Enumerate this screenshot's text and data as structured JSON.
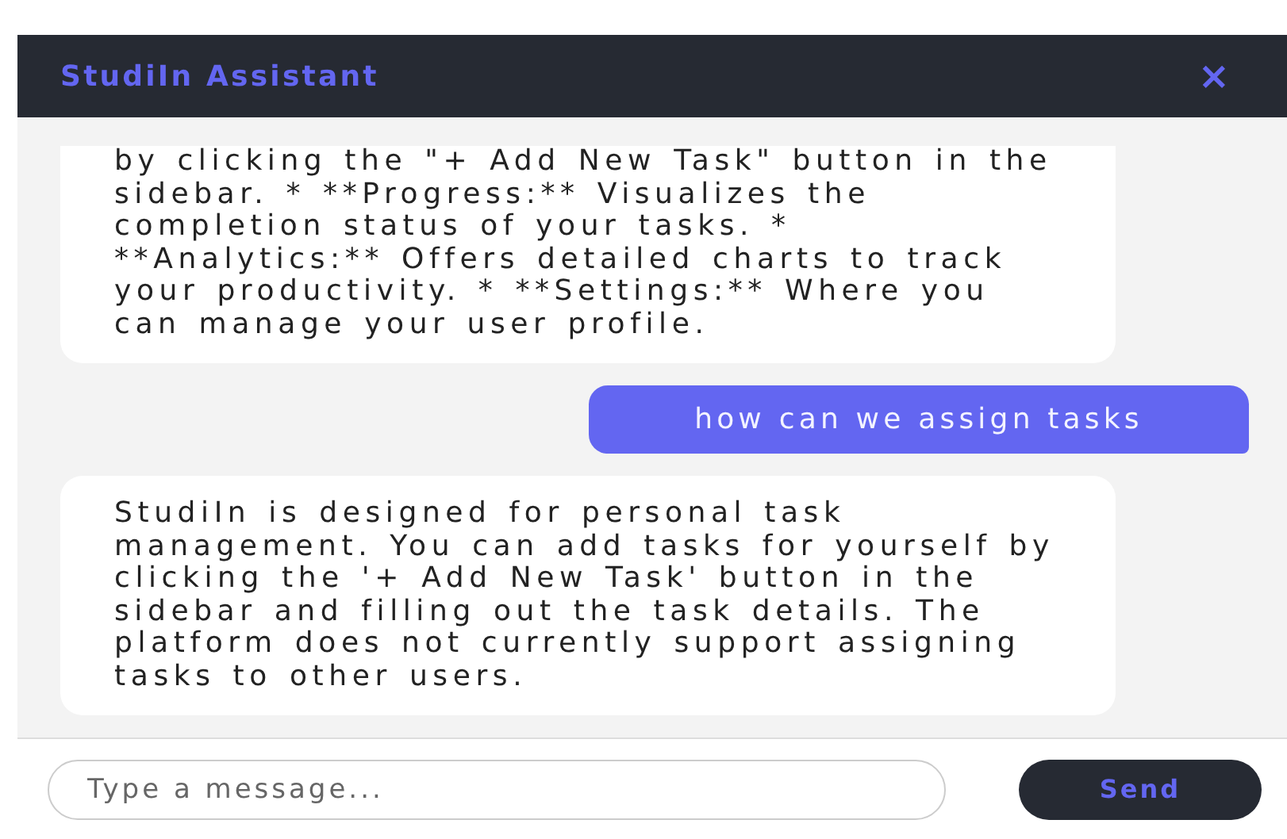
{
  "header": {
    "title": "StudiIn Assistant",
    "close": "×"
  },
  "messages": [
    {
      "kind": "bot",
      "text": "by clicking the \"+ Add New Task\" button in the sidebar. * **Progress:** Visualizes the completion status of your tasks. * **Analytics:** Offers detailed charts to track your productivity. * **Settings:** Where you can manage your user profile."
    },
    {
      "kind": "user",
      "text": "how can we assign tasks"
    },
    {
      "kind": "bot",
      "text": "StudiIn is designed for personal task management. You can add tasks for yourself by clicking the '+ Add New Task' button in the sidebar and filling out the task details. The platform does not currently support assigning tasks to other users."
    }
  ],
  "composer": {
    "placeholder": "Type a message...",
    "button": "Send"
  }
}
